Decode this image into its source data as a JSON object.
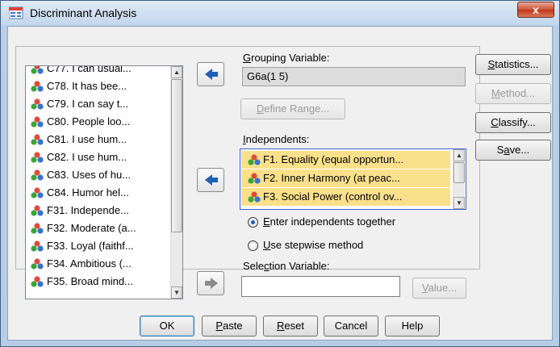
{
  "window": {
    "title": "Discriminant Analysis",
    "close_label": "x"
  },
  "variable_list": {
    "items": [
      "C77. I can usual...",
      "C78.  It has bee...",
      "C79.  I can say t...",
      "C80.  People loo...",
      "C81.  I use hum...",
      "C82.  I use hum...",
      "C83.  Uses of hu...",
      "C84.  Humor hel...",
      "F31. Independe...",
      "F32. Moderate (a...",
      "F33. Loyal (faithf...",
      "F34. Ambitious (...",
      "F35. Broad mind..."
    ]
  },
  "grouping": {
    "label": "Grouping Variable:",
    "label_key": "G",
    "label_rest": "rouping Variable:",
    "value": "G6a(1 5)",
    "define_range_key": "D",
    "define_range_rest": "efine Range..."
  },
  "independents": {
    "label_key": "I",
    "label_rest": "ndependents:",
    "items": [
      "F1. Equality (equal opportun...",
      "F2. Inner Harmony (at peac...",
      "F3. Social Power (control ov..."
    ],
    "radio_together": {
      "key": "E",
      "rest": "nter independents together",
      "checked": true
    },
    "radio_stepwise": {
      "key": "U",
      "rest": "se stepwise method",
      "checked": false
    }
  },
  "selection": {
    "label_pre": "Sele",
    "label_key": "c",
    "label_rest": "tion Variable:",
    "value": "",
    "value_btn_key": "V",
    "value_btn_rest": "alue..."
  },
  "side_buttons": {
    "statistics_key": "S",
    "statistics_rest": "tatistics...",
    "method_key": "M",
    "method_rest": "ethod...",
    "classify_key": "C",
    "classify_rest": "lassify...",
    "save_pre": "S",
    "save_key": "a",
    "save_rest": "ve..."
  },
  "bottom_buttons": {
    "ok": "OK",
    "paste_key": "P",
    "paste_rest": "aste",
    "reset_key": "R",
    "reset_rest": "eset",
    "cancel": "Cancel",
    "help": "Help"
  },
  "colors": {
    "selected_bg": "#fbe08b",
    "focus_border": "#3a5fcd",
    "arrow_blue": "#1f5fb4"
  }
}
